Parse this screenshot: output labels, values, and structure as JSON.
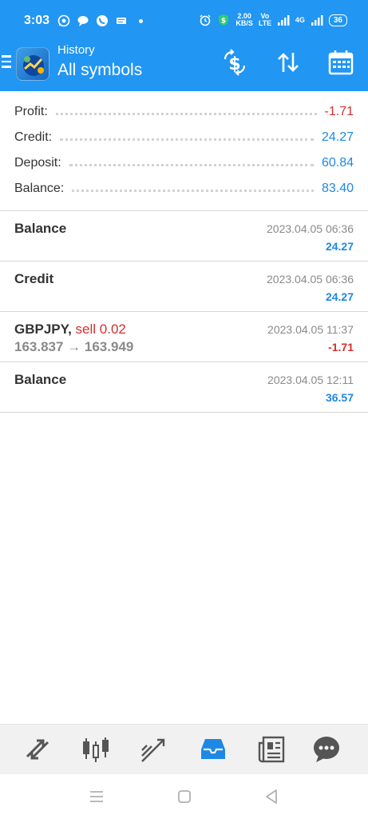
{
  "status_bar": {
    "time": "3:03",
    "net_speed_value": "2.00",
    "net_speed_unit": "KB/S",
    "volte": "Vo LTE",
    "network": "4G",
    "battery": "36"
  },
  "app_bar": {
    "title": "History",
    "subtitle": "All symbols",
    "icons": [
      "menu-icon",
      "app-logo",
      "currency-swap-icon",
      "sort-icon",
      "calendar-icon"
    ]
  },
  "summary": [
    {
      "label": "Profit:",
      "value": "-1.71",
      "color": "#d32f2f"
    },
    {
      "label": "Credit:",
      "value": "24.27",
      "color": "#1e88e5"
    },
    {
      "label": "Deposit:",
      "value": "60.84",
      "color": "#1e88e5"
    },
    {
      "label": "Balance:",
      "value": "83.40",
      "color": "#1e88e5"
    }
  ],
  "deals": [
    {
      "title": "Balance",
      "time": "2023.04.05 06:36",
      "value": "24.27",
      "value_color": "#1e88e5"
    },
    {
      "title": "Credit",
      "time": "2023.04.05 06:36",
      "value": "24.27",
      "value_color": "#1e88e5"
    },
    {
      "title": "GBPJPY,",
      "type": " sell 0.02",
      "prices": "163.837 → 163.949",
      "time": "2023.04.05 11:37",
      "value": "-1.71",
      "value_color": "#d32f2f"
    },
    {
      "title": "Balance",
      "time": "2023.04.05 12:11",
      "value": "36.57",
      "value_color": "#1e88e5"
    }
  ],
  "bottom_nav": {
    "items": [
      "quotes-icon",
      "chart-icon",
      "trade-icon",
      "history-icon",
      "news-icon",
      "chat-icon"
    ],
    "active": "history-icon",
    "accent": "#1e88e5",
    "inactive": "#555555"
  },
  "system_nav": [
    "recents-icon",
    "home-icon",
    "back-icon"
  ]
}
